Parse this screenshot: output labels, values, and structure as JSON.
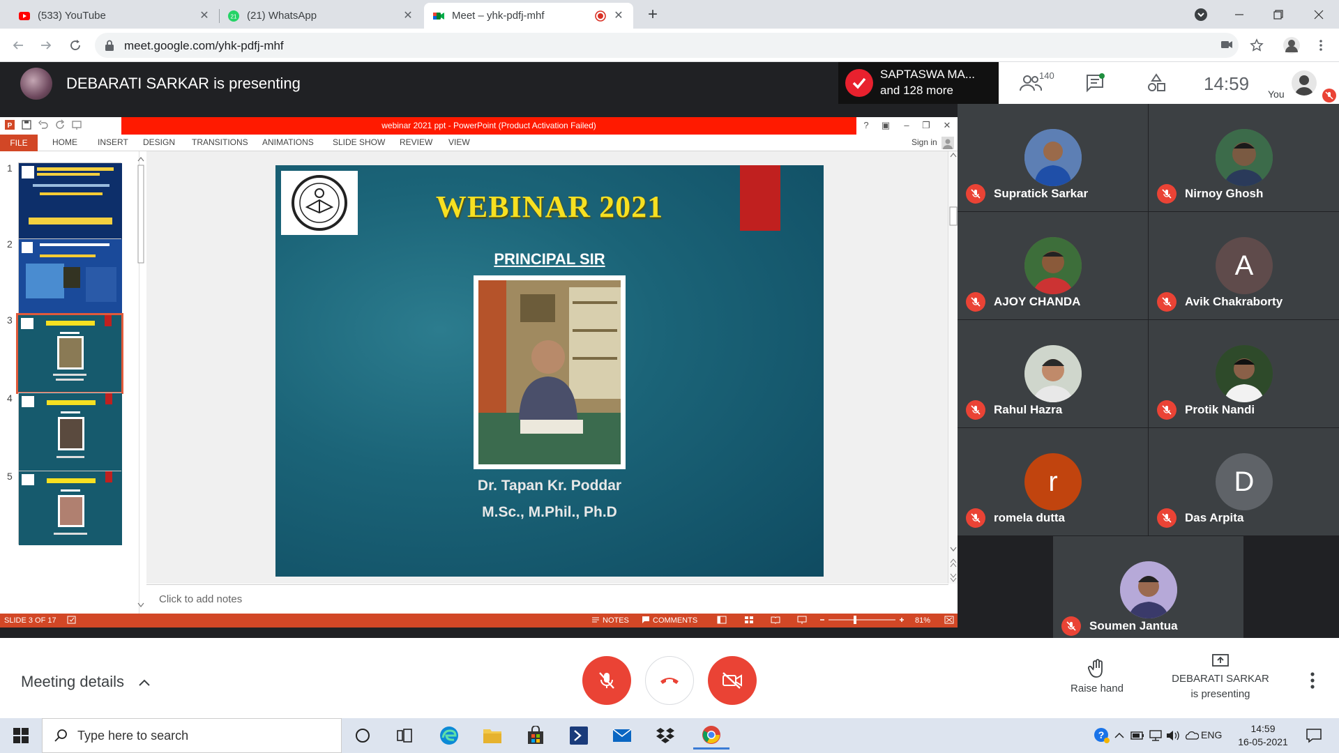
{
  "browser": {
    "tabs": [
      {
        "title": "(533) YouTube"
      },
      {
        "title": "(21) WhatsApp"
      },
      {
        "title": "Meet – yhk-pdfj-mhf"
      }
    ],
    "url": "meet.google.com/yhk-pdfj-mhf"
  },
  "meet": {
    "presenting_text": "DEBARATI SARKAR is presenting",
    "joined_name": "SAPTASWA MA...",
    "joined_more": "and 128 more",
    "people_count": "140",
    "clock": "14:59",
    "you_label": "You",
    "participants": [
      {
        "name": "Supratick Sarkar",
        "initial": "",
        "color": "#6b8fc4"
      },
      {
        "name": "Nirnoy Ghosh",
        "initial": "",
        "color": "#4f7a5a"
      },
      {
        "name": "AJOY CHANDA",
        "initial": "",
        "color": "#7a6a55"
      },
      {
        "name": "Avik Chakraborty",
        "initial": "A",
        "color": "#5f4b4b"
      },
      {
        "name": "Rahul Hazra",
        "initial": "",
        "color": "#8a9a88"
      },
      {
        "name": "Protik Nandi",
        "initial": "",
        "color": "#3e5a3a"
      },
      {
        "name": "romela dutta",
        "initial": "r",
        "color": "#c1440e"
      },
      {
        "name": "Das Arpita",
        "initial": "D",
        "color": "#5f6368"
      },
      {
        "name": "Soumen Jantua",
        "initial": "",
        "color": "#8b7fb0"
      }
    ],
    "bottom": {
      "meeting_details": "Meeting details",
      "raise_hand": "Raise hand",
      "present_line1": "DEBARATI SARKAR",
      "present_line2": "is presenting"
    }
  },
  "ppt": {
    "window_title": "webinar 2021 ppt - PowerPoint (Product Activation Failed)",
    "ribbon_tabs": [
      "FILE",
      "HOME",
      "INSERT",
      "DESIGN",
      "TRANSITIONS",
      "ANIMATIONS",
      "SLIDE SHOW",
      "REVIEW",
      "VIEW"
    ],
    "sign_in": "Sign in",
    "thumb_numbers": [
      "1",
      "2",
      "3",
      "4",
      "5"
    ],
    "slide": {
      "title": "WEBINAR 2021",
      "subtitle": "PRINCIPAL SIR",
      "name": "Dr. Tapan Kr. Poddar",
      "degrees": "M.Sc., M.Phil., Ph.D"
    },
    "notes_placeholder": "Click to add notes",
    "status": {
      "slide_counter": "SLIDE 3 OF 17",
      "notes": "NOTES",
      "comments": "COMMENTS",
      "zoom": "81%"
    }
  },
  "taskbar": {
    "search_placeholder": "Type here to search",
    "language": "ENG",
    "time": "14:59",
    "date": "16-05-2021"
  },
  "colors": {
    "meet_dark": "#202124",
    "mute_red": "#ea4335",
    "ppt_orange": "#d24726",
    "activation_red": "#ff1a00",
    "slide_title_yellow": "#f7e021"
  }
}
